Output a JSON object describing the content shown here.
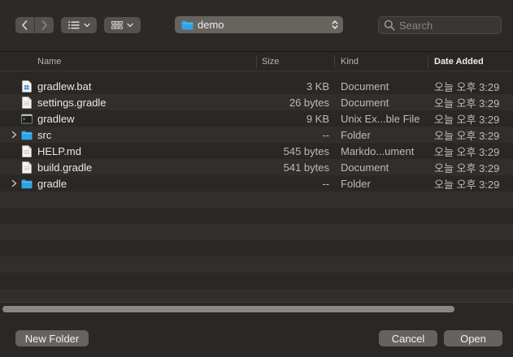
{
  "toolbar": {
    "path_label": "demo",
    "search_placeholder": "Search"
  },
  "columns": {
    "name": "Name",
    "size": "Size",
    "kind": "Kind",
    "date_added": "Date Added"
  },
  "files": [
    {
      "name": "gradlew.bat",
      "size": "3 KB",
      "kind": "Document",
      "date": "오늘 오후 3:29",
      "icon": "bat-file-icon",
      "folder": false
    },
    {
      "name": "settings.gradle",
      "size": "26 bytes",
      "kind": "Document",
      "date": "오늘 오후 3:29",
      "icon": "document-icon",
      "folder": false
    },
    {
      "name": "gradlew",
      "size": "9 KB",
      "kind": "Unix Ex...ble File",
      "date": "오늘 오후 3:29",
      "icon": "terminal-file-icon",
      "folder": false
    },
    {
      "name": "src",
      "size": "--",
      "kind": "Folder",
      "date": "오늘 오후 3:29",
      "icon": "folder-icon",
      "folder": true
    },
    {
      "name": "HELP.md",
      "size": "545 bytes",
      "kind": "Markdo...ument",
      "date": "오늘 오후 3:29",
      "icon": "document-icon",
      "folder": false
    },
    {
      "name": "build.gradle",
      "size": "541 bytes",
      "kind": "Document",
      "date": "오늘 오후 3:29",
      "icon": "document-icon",
      "folder": false
    },
    {
      "name": "gradle",
      "size": "--",
      "kind": "Folder",
      "date": "오늘 오후 3:29",
      "icon": "folder-icon",
      "folder": true
    }
  ],
  "buttons": {
    "new_folder": "New Folder",
    "cancel": "Cancel",
    "open": "Open"
  },
  "colors": {
    "folder": "#2fa3e6",
    "background": "#2b2724",
    "stripe": "#322e2b"
  }
}
